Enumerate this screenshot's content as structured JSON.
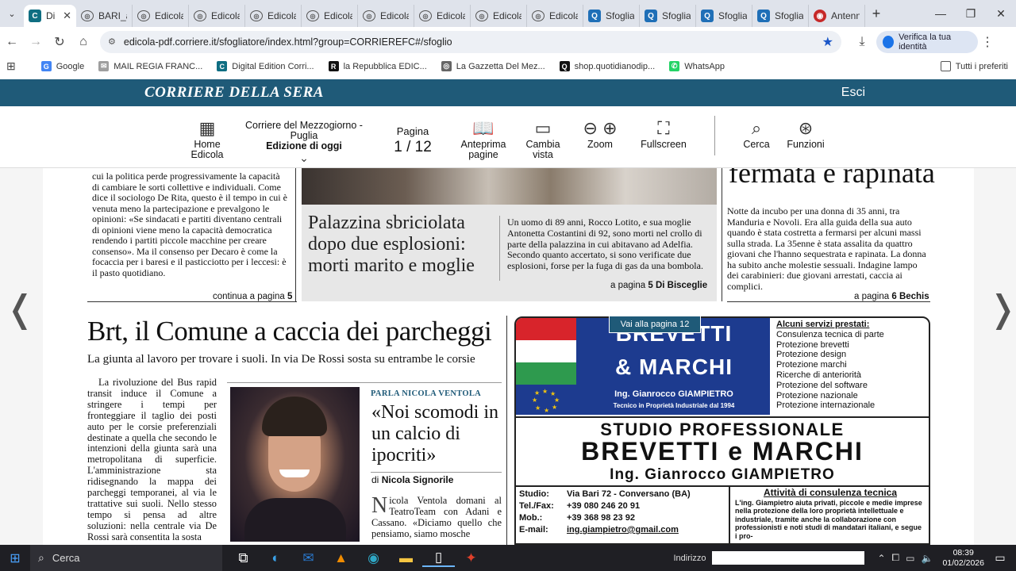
{
  "tabs": [
    {
      "label": "Di",
      "icon": "C",
      "iconType": "c",
      "active": true
    },
    {
      "label": "BARI_a",
      "icon": "◎",
      "iconType": "g"
    },
    {
      "label": "Edicola",
      "icon": "◎",
      "iconType": "g"
    },
    {
      "label": "Edicola",
      "icon": "◎",
      "iconType": "g"
    },
    {
      "label": "Edicola",
      "icon": "◎",
      "iconType": "g"
    },
    {
      "label": "Edicola",
      "icon": "◎",
      "iconType": "g"
    },
    {
      "label": "Edicola",
      "icon": "◎",
      "iconType": "g"
    },
    {
      "label": "Edicola",
      "icon": "◎",
      "iconType": "g"
    },
    {
      "label": "Edicola",
      "icon": "◎",
      "iconType": "g"
    },
    {
      "label": "Edicola",
      "icon": "◎",
      "iconType": "g"
    },
    {
      "label": "Sfoglia",
      "icon": "Q",
      "iconType": "q"
    },
    {
      "label": "Sfoglia",
      "icon": "Q",
      "iconType": "q"
    },
    {
      "label": "Sfoglia",
      "icon": "Q",
      "iconType": "q"
    },
    {
      "label": "Sfoglia",
      "icon": "Q",
      "iconType": "q"
    },
    {
      "label": "Antenn",
      "icon": "◉",
      "iconType": "r"
    }
  ],
  "address": {
    "url": "edicola-pdf.corriere.it/sfogliatore/index.html?group=CORRIEREFC#/sfoglio",
    "identity": "Verifica la tua identità"
  },
  "bookmarks": [
    {
      "label": "Google",
      "icon": "G",
      "color": "#4285f4"
    },
    {
      "label": "MAIL REGIA FRANC...",
      "icon": "✉",
      "color": "#9e9e9e"
    },
    {
      "label": "Digital Edition Corri...",
      "icon": "C",
      "color": "#0f6e82"
    },
    {
      "label": "la Repubblica EDIC...",
      "icon": "R",
      "color": "#111111"
    },
    {
      "label": "La Gazzetta Del Mez...",
      "icon": "◎",
      "color": "#666666"
    },
    {
      "label": "shop.quotidianodip...",
      "icon": "Q",
      "color": "#111111"
    },
    {
      "label": "WhatsApp",
      "icon": "✆",
      "color": "#25d366"
    }
  ],
  "bookmarks_right": "Tutti i preferiti",
  "site": {
    "logo": "CORRIERE DELLA SERA",
    "logout": "Esci"
  },
  "toolbar": {
    "home_l1": "Home",
    "home_l2": "Edicola",
    "pub_line1": "Corriere del Mezzogiorno -",
    "pub_line2": "Puglia",
    "pub_line3": "Edizione di oggi",
    "page_label": "Pagina",
    "page_value": "1 / 12",
    "preview_l1": "Anteprima",
    "preview_l2": "pagine",
    "view_l1": "Cambia",
    "view_l2": "vista",
    "zoom": "Zoom",
    "fullscreen": "Fullscreen",
    "search": "Cerca",
    "functions": "Funzioni"
  },
  "article_left_top": {
    "text": "cui la politica perde progressivamente la capacità di cambiare le sorti collettive e individuali. Come dice il sociologo De Rita, questo è il tempo in cui è venuta meno la partecipazione e prevalgono le opinioni: «Se sindacati e partiti diventano centrali di opinioni viene meno la capacità democratica rendendo i partiti piccole macchine per creare consenso». Ma il consenso per Decaro è come la focaccia per i baresi e il pasticciotto per i leccesi: è il pasto quotidiano.",
    "continua": "continua a pagina",
    "continua_page": "5"
  },
  "article_palazzina": {
    "title": "Palazzina sbriciolata dopo due esplosioni: morti marito e moglie",
    "text": "Un uomo di 89 anni, Rocco Lotito, e sua moglie Antonetta Costantini di 92, sono morti nel crollo di parte della palazzina in cui abitavano ad Adelfia. Secondo quanto accertato, si sono verificate due esplosioni, forse per la fuga di gas da una bombola.",
    "ref": "a pagina",
    "ref_page": "5",
    "ref_author": "Di Bisceglie"
  },
  "article_right": {
    "title": "fermata e rapinata",
    "text": "Notte da incubo per una donna di 35 anni, tra Manduria e Novoli. Era alla guida della sua auto quando è stata costretta a fermarsi per alcuni massi sulla strada. La 35enne è stata assalita da quattro giovani che l'hanno sequestrata e rapinata. La donna ha subito anche molestie sessuali. Indagine lampo dei carabinieri: due giovani arrestati, caccia ai complici.",
    "ref": "a pagina",
    "ref_page": "6",
    "ref_author": "Bechis"
  },
  "article_brt": {
    "title": "Brt, il Comune a caccia dei parcheggi",
    "subtitle": "La giunta al lavoro per trovare i suoli. In via De Rossi sosta su entrambe le corsie",
    "body": "La rivoluzione del Bus rapid transit induce il Comune a stringere i tempi per fronteggiare il taglio dei posti auto per le corsie preferenziali destinate a quella che secondo le intenzioni della giunta sarà una metropolitana di superficie. L'amministrazione sta ridisegnando la mappa dei parcheggi temporanei, al via le trattative sui suoli. Nello stesso tempo si pensa ad altre soluzioni: nella centrale via De Rossi sarà consentita la sosta"
  },
  "article_ventola": {
    "kicker": "PARLA NICOLA VENTOLA",
    "title": "«Noi scomodi in un calcio di ipocriti»",
    "byline_prefix": "di",
    "byline": "Nicola Signorile",
    "dropcap": "N",
    "body": "icola Ventola domani al TeatroTeam con Adani e Cassano. «Diciamo quello che pensiamo, siamo mosche"
  },
  "ad": {
    "brand1": "BREVETTI",
    "brand2": "& MARCHI",
    "engineer": "Ing. Gianrocco GIAMPIETRO",
    "tech": "Tecnico in Proprietà Industriale dal 1994",
    "services_title": "Alcuni servizi prestati:",
    "services": [
      "Consulenza tecnica di parte",
      "Protezione brevetti",
      "Protezione design",
      "Protezione marchi",
      "Ricerche di anteriorità",
      "Protezione del software",
      "Protezione nazionale",
      "Protezione internazionale"
    ],
    "studio": "STUDIO PROFESSIONALE",
    "brand_big": "BREVETTI e MARCHI",
    "engineer_big": "Ing. Gianrocco GIAMPIETRO",
    "contacts": [
      {
        "k": "Studio:",
        "v": "Via Bari 72 - Conversano (BA)"
      },
      {
        "k": "Tel./Fax:",
        "v": "+39 080 246 20 91"
      },
      {
        "k": "Mob.:",
        "v": "+39 368 98 23 92"
      },
      {
        "k": "E-mail:",
        "v": "ing.giampietro@gmail.com"
      }
    ],
    "consul_title": "Attività di consulenza tecnica",
    "consul_text": "L'ing. Giampietro aiuta privati, piccole e medie imprese nella protezione della loro proprietà intellettuale e industriale, tramite anche la collaborazione con professionisti e noti studi di mandatari italiani, e segue i pro-"
  },
  "tooltip": "Vai alla pagina 12",
  "taskbar": {
    "search": "Cerca",
    "address_label": "Indirizzo",
    "time": "08:39",
    "date": "01/02/2026"
  }
}
